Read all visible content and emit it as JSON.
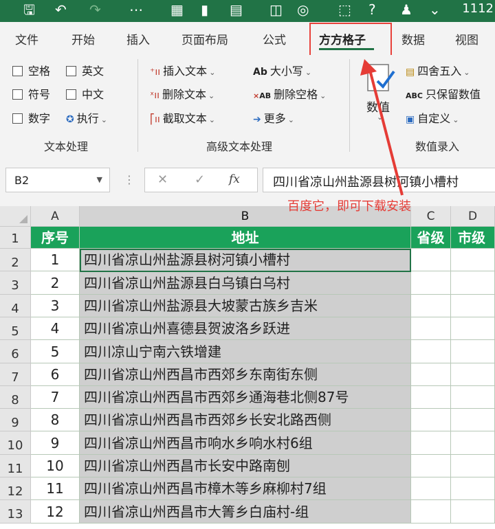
{
  "titlebar": {
    "title": "1112"
  },
  "tabs": [
    {
      "label": "文件"
    },
    {
      "label": "开始"
    },
    {
      "label": "插入"
    },
    {
      "label": "页面布局"
    },
    {
      "label": "公式"
    },
    {
      "label": "方方格子"
    },
    {
      "label": "数据"
    },
    {
      "label": "视图"
    }
  ],
  "ribbon": {
    "text_group": {
      "checkboxes": [
        "空格",
        "英文",
        "符号",
        "中文",
        "数字"
      ],
      "execute_label": "执行",
      "label": "文本处理"
    },
    "advanced_group": {
      "insert_text": "插入文本",
      "delete_text": "删除文本",
      "extract_text": "截取文本",
      "case": "大小写",
      "delete_space": "删除空格",
      "more": "更多",
      "label": "高级文本处理"
    },
    "numeric_group": {
      "big_button": "数值",
      "round": "四舍五入",
      "keep_value": "只保留数值",
      "custom": "自定义",
      "label": "数值录入"
    }
  },
  "formula_bar": {
    "name_box": "B2",
    "fx": "fx",
    "content": "四川省凉山州盐源县树河镇小槽村"
  },
  "annotation": "百度它，即可下载安装",
  "sheet": {
    "columns": [
      "A",
      "B",
      "C",
      "D"
    ],
    "header_row": {
      "row": "1",
      "cells": [
        "序号",
        "地址",
        "省级",
        "市级"
      ]
    },
    "rows": [
      {
        "row": "2",
        "seq": "1",
        "address": "四川省凉山州盐源县树河镇小槽村"
      },
      {
        "row": "3",
        "seq": "2",
        "address": "四川省凉山州盐源县白乌镇白乌村"
      },
      {
        "row": "4",
        "seq": "3",
        "address": "四川省凉山州盐源县大坡蒙古族乡吉米"
      },
      {
        "row": "5",
        "seq": "4",
        "address": "四川省凉山州喜德县贺波洛乡跃进"
      },
      {
        "row": "6",
        "seq": "5",
        "address": "四川凉山宁南六铁增建"
      },
      {
        "row": "7",
        "seq": "6",
        "address": "四川省凉山州西昌市西郊乡东南街东侧"
      },
      {
        "row": "8",
        "seq": "7",
        "address": "四川省凉山州西昌市西郊乡通海巷北侧87号"
      },
      {
        "row": "9",
        "seq": "8",
        "address": "四川省凉山州西昌市西郊乡长安北路西侧"
      },
      {
        "row": "10",
        "seq": "9",
        "address": "四川省凉山州西昌市响水乡响水村6组"
      },
      {
        "row": "11",
        "seq": "10",
        "address": "四川省凉山州西昌市长安中路南刨"
      },
      {
        "row": "12",
        "seq": "11",
        "address": "四川省凉山州西昌市樟木等乡麻柳村7组"
      },
      {
        "row": "13",
        "seq": "12",
        "address": "四川省凉山州西昌市大箐乡白庙村-组"
      }
    ]
  },
  "colors": {
    "excel_green": "#217346",
    "header_green": "#1aa25a",
    "selection_gray": "#cfcfcf",
    "annotation_red": "#e53c36"
  }
}
